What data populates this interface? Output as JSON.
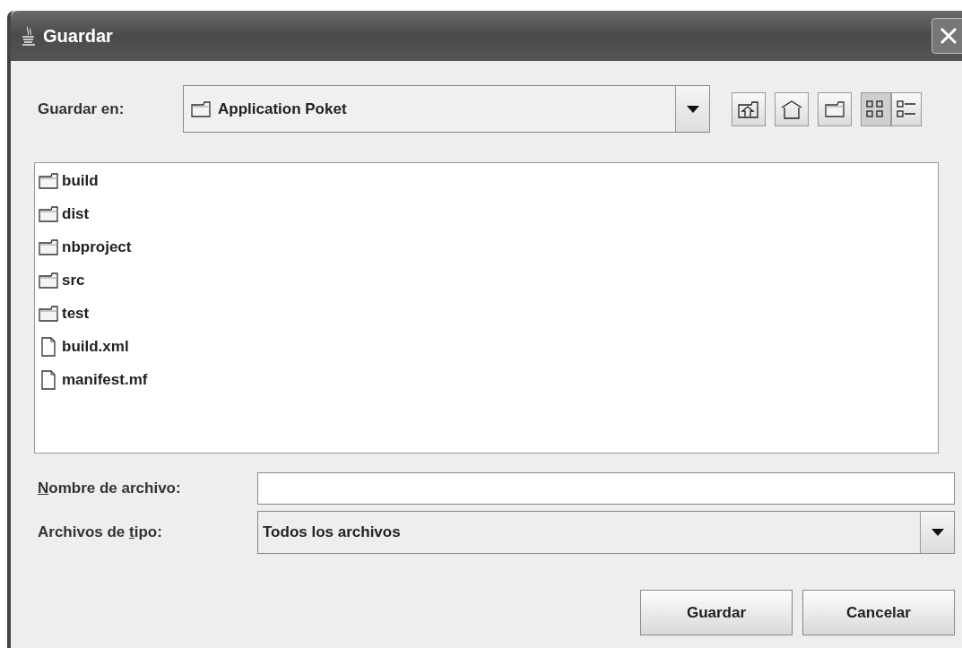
{
  "window": {
    "title": "Guardar"
  },
  "location": {
    "label": "Guardar en:",
    "value": "Application Poket"
  },
  "view_buttons": [
    {
      "kind": "list",
      "selected": true
    },
    {
      "kind": "details",
      "selected": false
    }
  ],
  "files": [
    {
      "kind": "folder",
      "name": "build"
    },
    {
      "kind": "folder",
      "name": "dist"
    },
    {
      "kind": "folder",
      "name": "nbproject"
    },
    {
      "kind": "folder",
      "name": "src"
    },
    {
      "kind": "folder",
      "name": "test"
    },
    {
      "kind": "file",
      "name": "build.xml"
    },
    {
      "kind": "file",
      "name": "manifest.mf"
    }
  ],
  "file_name": {
    "label": {
      "mnemonic": "N",
      "after": "ombre de archivo:"
    }
  },
  "file_type": {
    "label": {
      "before": "Archivos de ",
      "mnemonic": "t",
      "after": "ipo:"
    },
    "value": "Todos los archivos"
  },
  "buttons": [
    "Guardar",
    "Cancelar"
  ]
}
